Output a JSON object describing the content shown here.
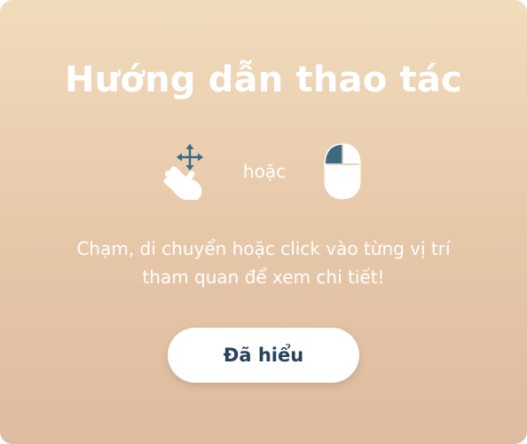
{
  "dialog": {
    "title": "Hướng dẫn thao tác",
    "or_label": "hoặc",
    "description_line1": "Chạm, di chuyển hoặc click vào từng vị trí",
    "description_line2": "tham quan để xem chi tiết!",
    "confirm_label": "Đã hiểu"
  },
  "icons": {
    "hand": "hand-drag-icon",
    "mouse": "mouse-left-click-icon"
  },
  "colors": {
    "background_top": "#f0dcbc",
    "background_bottom": "#dfbba0",
    "text": "#ffffff",
    "button_text": "#26435b",
    "icon_accent": "#3c6a84"
  }
}
